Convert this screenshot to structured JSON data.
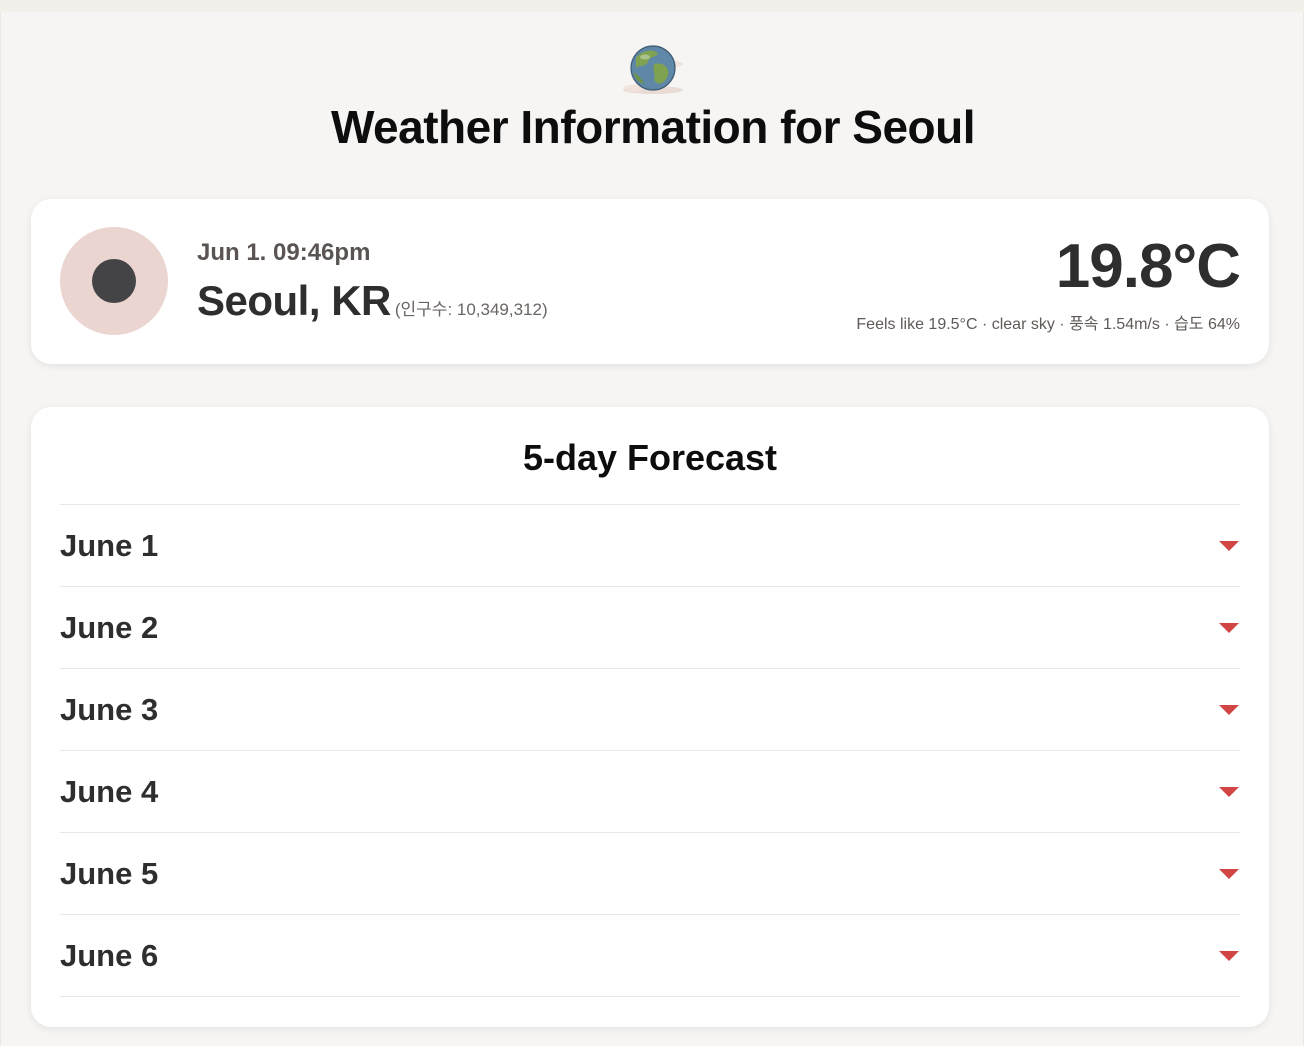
{
  "header": {
    "globe_icon": "globe-icon",
    "title": "Weather Information for Seoul"
  },
  "current": {
    "icon": "clear-sky-icon",
    "datetime": "Jun 1. 09:46pm",
    "city": "Seoul, KR",
    "population": "(인구수: 10,349,312)",
    "temperature": "19.8°C",
    "details": "Feels like 19.5°C · clear sky · 풍속 1.54m/s · 습도 64%"
  },
  "forecast": {
    "title": "5-day Forecast",
    "days": [
      {
        "label": "June 1"
      },
      {
        "label": "June 2"
      },
      {
        "label": "June 3"
      },
      {
        "label": "June 4"
      },
      {
        "label": "June 5"
      },
      {
        "label": "June 6"
      }
    ]
  },
  "colors": {
    "accent": "#d14545",
    "icon_bg": "#ead5d0",
    "icon_dot": "#444447",
    "page_bg": "#f7f5f3"
  }
}
